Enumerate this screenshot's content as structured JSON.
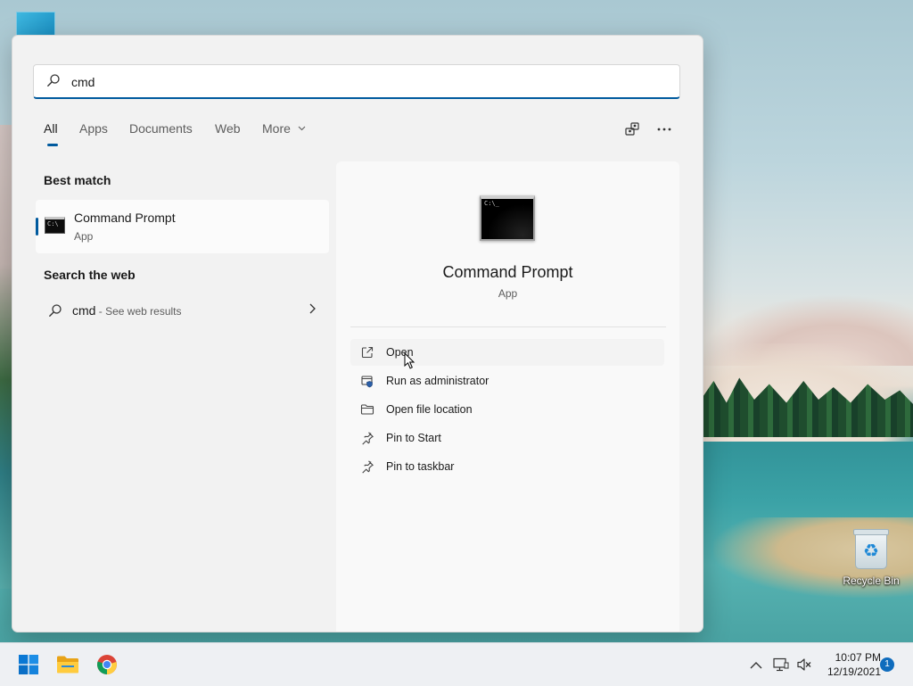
{
  "desktop": {
    "recycle_bin_label": "Recycle Bin"
  },
  "search": {
    "query": "cmd",
    "placeholder": ""
  },
  "tabs": [
    {
      "label": "All",
      "active": true
    },
    {
      "label": "Apps"
    },
    {
      "label": "Documents"
    },
    {
      "label": "Web"
    },
    {
      "label": "More"
    }
  ],
  "results": {
    "best_match_heading": "Best match",
    "best_match": {
      "name": "Command Prompt",
      "type": "App",
      "icon": "terminal-icon"
    },
    "web_heading": "Search the web",
    "web_result": {
      "query": "cmd",
      "suffix": " - See web results"
    }
  },
  "details": {
    "title": "Command Prompt",
    "type": "App",
    "actions": [
      {
        "label": "Open",
        "icon": "open-external-icon"
      },
      {
        "label": "Run as administrator",
        "icon": "shield-icon"
      },
      {
        "label": "Open file location",
        "icon": "folder-icon"
      },
      {
        "label": "Pin to Start",
        "icon": "pin-icon"
      },
      {
        "label": "Pin to taskbar",
        "icon": "pin-icon"
      }
    ]
  },
  "taskbar": {
    "time": "10:07 PM",
    "date": "12/19/2021",
    "notification_count": "1",
    "apps": [
      "start-icon",
      "file-explorer-icon",
      "chrome-icon"
    ]
  },
  "colors": {
    "accent": "#005a9e",
    "flyout_bg": "#f2f2f2",
    "taskbar_bg": "#eef0f3",
    "badge": "#0f6cbd"
  }
}
